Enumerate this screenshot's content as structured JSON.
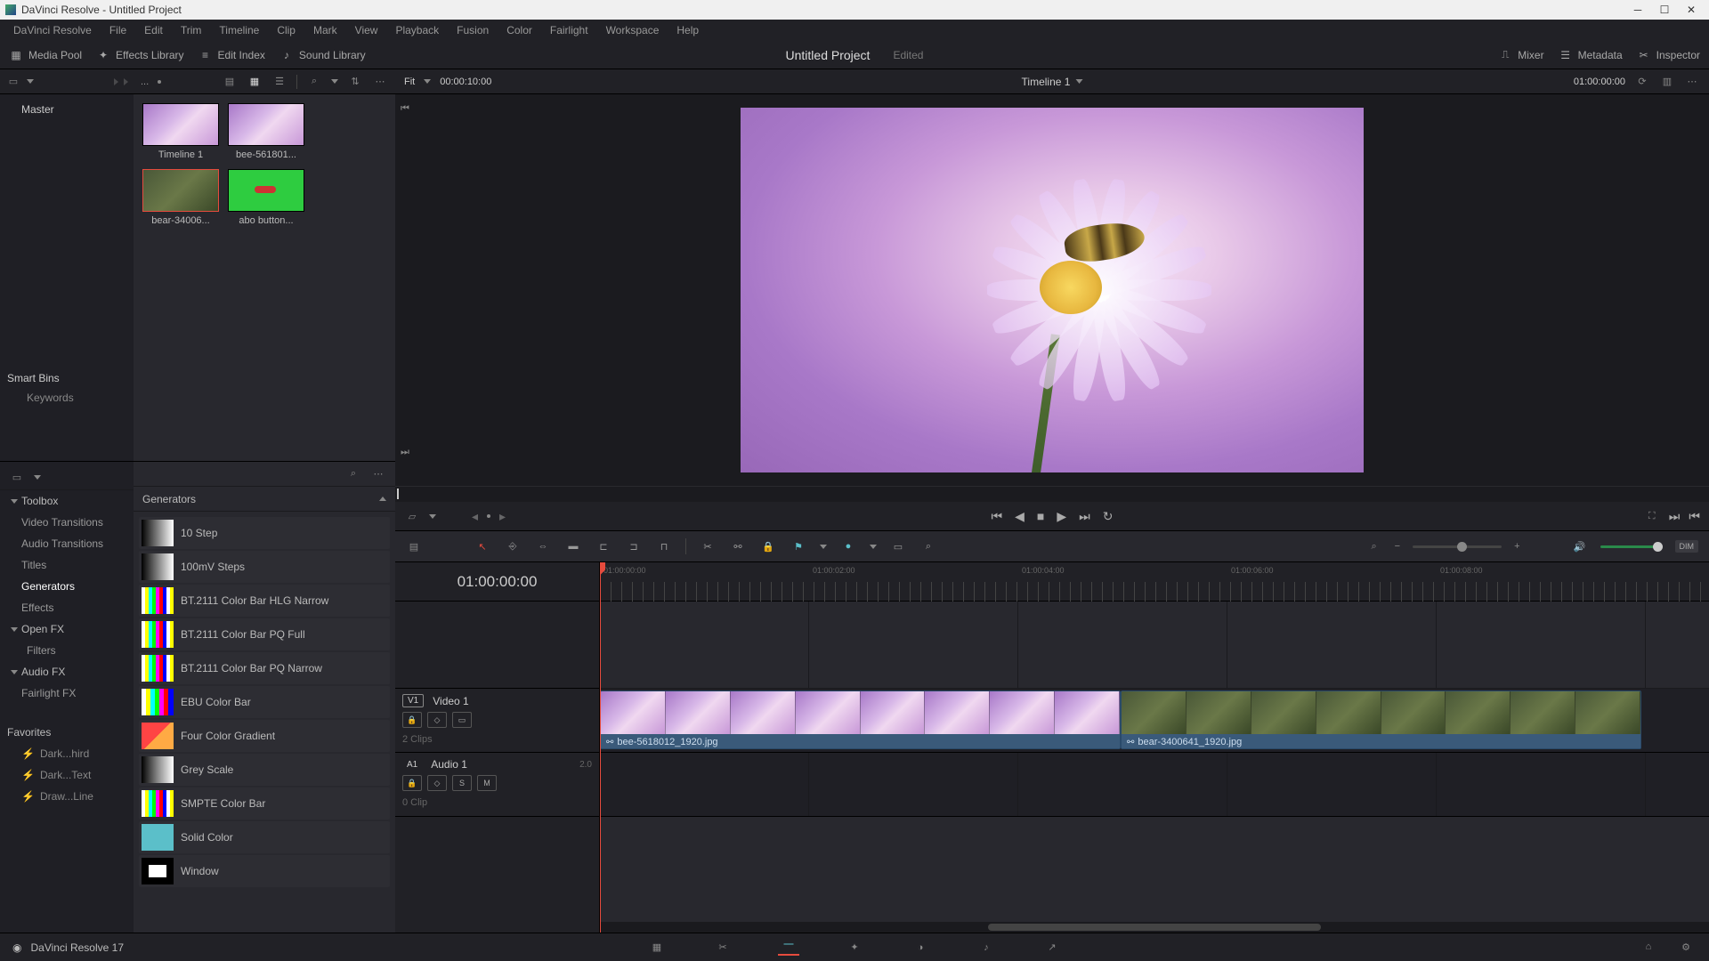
{
  "window": {
    "title": "DaVinci Resolve - Untitled Project"
  },
  "menubar": [
    "DaVinci Resolve",
    "File",
    "Edit",
    "Trim",
    "Timeline",
    "Clip",
    "Mark",
    "View",
    "Playback",
    "Fusion",
    "Color",
    "Fairlight",
    "Workspace",
    "Help"
  ],
  "uibar": {
    "media_pool": "Media Pool",
    "effects_library": "Effects Library",
    "edit_index": "Edit Index",
    "sound_library": "Sound Library",
    "mixer": "Mixer",
    "metadata": "Metadata",
    "inspector": "Inspector",
    "project_title": "Untitled Project",
    "project_edited": "Edited"
  },
  "bins": {
    "master": "Master",
    "smart_bins": "Smart Bins",
    "keywords": "Keywords"
  },
  "pool_toolbar": {
    "dots": "..."
  },
  "clips": [
    {
      "name": "Timeline 1",
      "kind": "timeline"
    },
    {
      "name": "bee-561801...",
      "kind": "flower"
    },
    {
      "name": "bear-34006...",
      "kind": "bear",
      "selected": true
    },
    {
      "name": "abo button...",
      "kind": "green"
    }
  ],
  "viewer": {
    "fit": "Fit",
    "source_tc": "00:00:10:00",
    "timeline_name": "Timeline 1",
    "record_tc": "01:00:00:00"
  },
  "effects": {
    "toolbox": "Toolbox",
    "cats": [
      "Video Transitions",
      "Audio Transitions",
      "Titles",
      "Generators",
      "Effects"
    ],
    "open_fx": "Open FX",
    "filters": "Filters",
    "audio_fx": "Audio FX",
    "fairlight_fx": "Fairlight FX",
    "favorites": "Favorites",
    "fav_items": [
      "Dark...hird",
      "Dark...Text",
      "Draw...Line"
    ],
    "list_header": "Generators",
    "items": [
      {
        "label": "10 Step",
        "sw": "sw-gradient"
      },
      {
        "label": "100mV Steps",
        "sw": "sw-gradient"
      },
      {
        "label": "BT.2111 Color Bar HLG Narrow",
        "sw": "sw-bars"
      },
      {
        "label": "BT.2111 Color Bar PQ Full",
        "sw": "sw-bars"
      },
      {
        "label": "BT.2111 Color Bar PQ Narrow",
        "sw": "sw-bars"
      },
      {
        "label": "EBU Color Bar",
        "sw": "sw-ebu"
      },
      {
        "label": "Four Color Gradient",
        "sw": "sw-4color"
      },
      {
        "label": "Grey Scale",
        "sw": "sw-grey"
      },
      {
        "label": "SMPTE Color Bar",
        "sw": "sw-bars"
      },
      {
        "label": "Solid Color",
        "sw": "sw-solid"
      },
      {
        "label": "Window",
        "sw": "sw-window"
      }
    ]
  },
  "timeline": {
    "timecode": "01:00:00:00",
    "ruler_marks": [
      "01:00:00:00",
      "01:00:02:00",
      "01:00:04:00",
      "01:00:06:00",
      "01:00:08:00"
    ],
    "video_track": {
      "badge": "V1",
      "name": "Video 1",
      "clips": "2 Clips"
    },
    "audio_track": {
      "badge": "A1",
      "name": "Audio 1",
      "meta": "2.0",
      "mute": "M",
      "solo": "S",
      "clips": "0 Clip"
    },
    "clip1": "bee-5618012_1920.jpg",
    "clip2": "bear-3400641_1920.jpg"
  },
  "toolbar": {
    "dim": "DIM"
  },
  "footer": {
    "app": "DaVinci Resolve 17"
  }
}
